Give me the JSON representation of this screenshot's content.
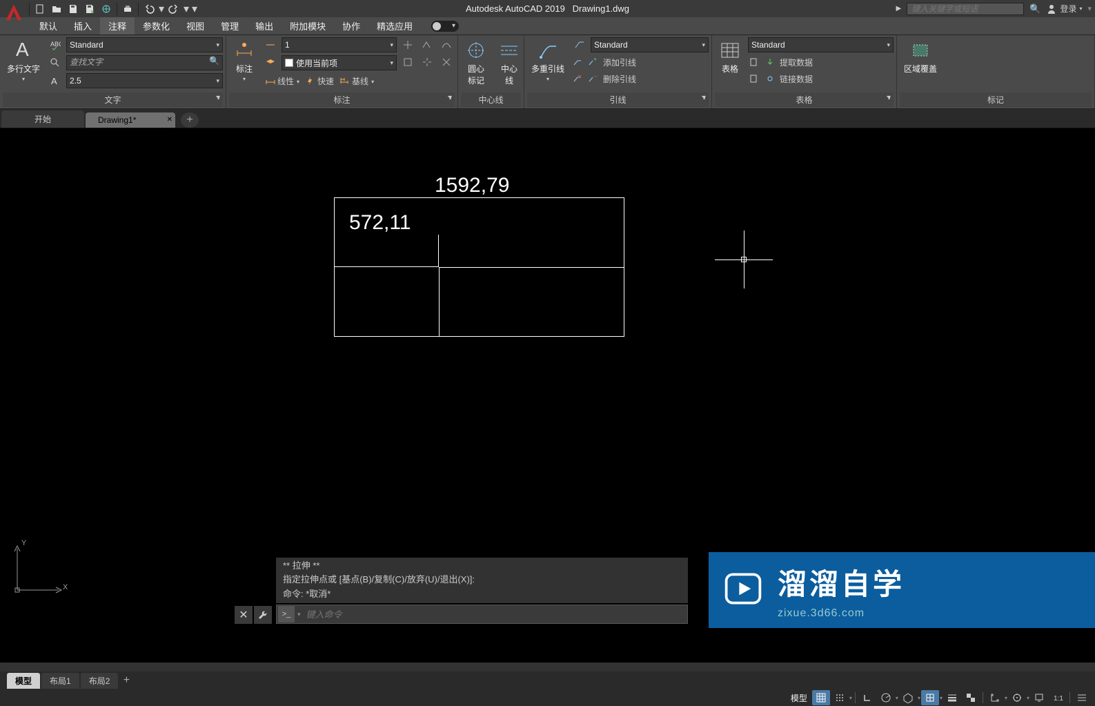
{
  "title": {
    "app": "Autodesk AutoCAD 2019",
    "file": "Drawing1.dwg"
  },
  "search_placeholder": "键入关键字或短语",
  "login_label": "登录",
  "menu": [
    "默认",
    "插入",
    "注释",
    "参数化",
    "视图",
    "管理",
    "输出",
    "附加模块",
    "协作",
    "精选应用"
  ],
  "menu_active": 2,
  "ribbon": {
    "text": {
      "title": "文字",
      "mtext": "多行文字",
      "style": "Standard",
      "find_placeholder": "查找文字",
      "height": "2.5"
    },
    "dim": {
      "title": "标注",
      "label": "标注",
      "scale": "1",
      "layer": "使用当前项",
      "linear": "线性",
      "quick": "快速",
      "continue": "基线"
    },
    "center": {
      "title": "中心线",
      "mark": "圆心\n标记",
      "line": "中心线"
    },
    "leader": {
      "title": "引线",
      "mleader": "多重引线",
      "style": "Standard",
      "add": "添加引线",
      "remove": "删除引线"
    },
    "table": {
      "title": "表格",
      "label": "表格",
      "style": "Standard",
      "extract": "提取数据",
      "link": "链接数据"
    },
    "wipeout": {
      "title": "标记",
      "label": "区域覆盖"
    }
  },
  "doc_tabs": {
    "start": "开始",
    "current": "Drawing1*"
  },
  "drawing": {
    "dim1": "1592,79",
    "dim2": "572,11"
  },
  "ucs": {
    "x": "X",
    "y": "Y"
  },
  "cmd": {
    "hist1": "** 拉伸 **",
    "hist2": "指定拉伸点或 [基点(B)/复制(C)/放弃(U)/退出(X)]:",
    "hist3": "命令: *取消*",
    "placeholder": "键入命令"
  },
  "layout_tabs": [
    "模型",
    "布局1",
    "布局2"
  ],
  "status": {
    "model": "模型"
  },
  "watermark": {
    "text": "溜溜自学",
    "sub": "zixue.3d66.com"
  }
}
